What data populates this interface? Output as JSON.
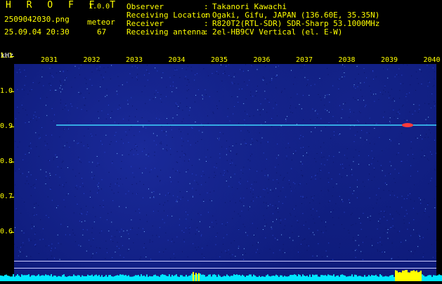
{
  "header": {
    "brand": "H R O F F T",
    "version": "1.0.0",
    "filename": "2509042030.png",
    "datetime": "25.09.04 20:30",
    "meteor_label": "meteor",
    "meteor_count": "67",
    "info": [
      {
        "label": "Observer",
        "value": "Takanori Kawachi"
      },
      {
        "label": "Receiving Location",
        "value": "Ogaki, Gifu, JAPAN (136.60E, 35.35N)"
      },
      {
        "label": "Receiver",
        "value": "R820T2(RTL-SDR) SDR-Sharp 53.1000MHz"
      },
      {
        "label": "Receiving antenna",
        "value": "2el-HB9CV Vertical (el. E-W)"
      }
    ],
    "separator": ":"
  },
  "chart_data": {
    "type": "heatmap",
    "ylabel": "kHz",
    "y_ticks": [
      "1.1",
      "1.0",
      "0.9",
      "0.8",
      "0.7",
      "0.6"
    ],
    "x_ticks": [
      "2031",
      "2032",
      "2033",
      "2034",
      "2035",
      "2036",
      "2037",
      "2038",
      "2039",
      "2040"
    ],
    "signal_frequency_khz": 0.905,
    "colors": {
      "background": "#0d1a78",
      "signal": "#3fd6ff",
      "text": "#ffff00",
      "hotspot": "#ff3a3a"
    }
  }
}
